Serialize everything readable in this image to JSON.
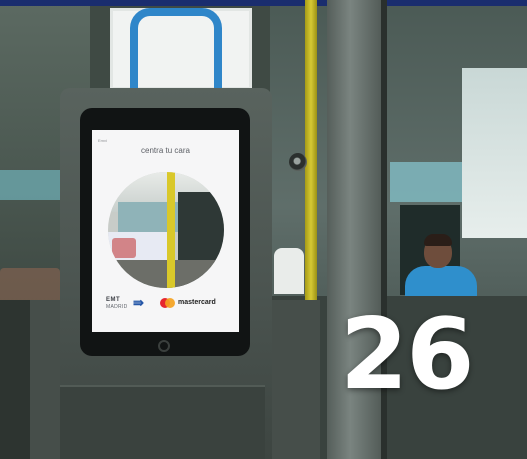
{
  "photo": {
    "screen": {
      "prompt": "centra tu cara",
      "tiny_text": "Emvi"
    },
    "logos": {
      "transit_operator": {
        "name": "EMT",
        "sub": "MADRID"
      },
      "payment_brand": "mastercard"
    },
    "overlay": {
      "issue_number": "26"
    }
  },
  "colors": {
    "emt_blue": "#2657a8",
    "mastercard_red": "#e6262e",
    "mastercard_yellow": "#f4a21f",
    "pole_yellow": "#d6c934",
    "frame_blue": "#2f86c9"
  }
}
